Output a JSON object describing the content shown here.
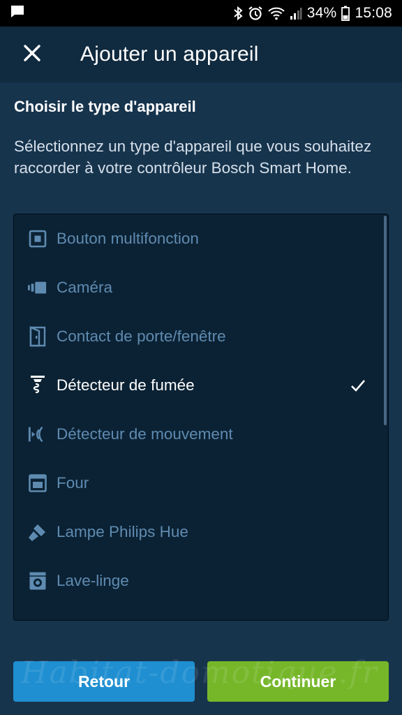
{
  "status_bar": {
    "battery_percent": "34%",
    "time": "15:08",
    "icons": [
      "message-icon",
      "bluetooth-icon",
      "alarm-icon",
      "wifi-icon",
      "signal-icon",
      "battery-icon"
    ]
  },
  "app_bar": {
    "title": "Ajouter un appareil",
    "close_icon": "close-icon"
  },
  "section": {
    "title": "Choisir le type d'appareil",
    "description": "Sélectionnez un type d'appareil que vous souhaitez raccorder à votre contrôleur Bosch Smart Home."
  },
  "device_list": {
    "items": [
      {
        "label": "Bouton multifonction",
        "icon": "multifunction-button-icon",
        "selected": false
      },
      {
        "label": "Caméra",
        "icon": "camera-icon",
        "selected": false
      },
      {
        "label": "Contact de porte/fenêtre",
        "icon": "door-window-contact-icon",
        "selected": false
      },
      {
        "label": "Détecteur de fumée",
        "icon": "smoke-detector-icon",
        "selected": true
      },
      {
        "label": "Détecteur de mouvement",
        "icon": "motion-detector-icon",
        "selected": false
      },
      {
        "label": "Four",
        "icon": "oven-icon",
        "selected": false
      },
      {
        "label": "Lampe Philips Hue",
        "icon": "lamp-icon",
        "selected": false
      },
      {
        "label": "Lave-linge",
        "icon": "washing-machine-icon",
        "selected": false
      }
    ]
  },
  "buttons": {
    "back": "Retour",
    "next": "Continuer"
  },
  "watermark": "Habitat-domotique.fr",
  "colors": {
    "background": "#17344d",
    "app_bar": "#102a3f",
    "list_background": "#0b2234",
    "item_text": "#5f8bb1",
    "back_button": "#1f8fd1",
    "next_button": "#76b72a"
  }
}
